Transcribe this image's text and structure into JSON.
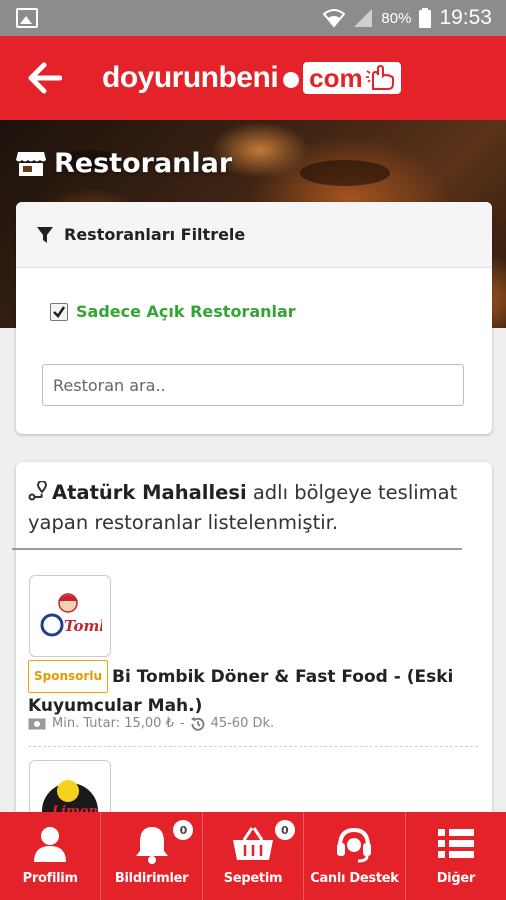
{
  "status_bar": {
    "battery": "80%",
    "time": "19:53"
  },
  "header": {
    "logo_main": "doyurunbeni",
    "logo_com": "com"
  },
  "page": {
    "title": "Restoranlar"
  },
  "filter": {
    "heading": "Restoranları Filtrele",
    "open_only_label": "Sadece Açık Restoranlar",
    "open_only_checked": true,
    "search_placeholder": "Restoran ara.."
  },
  "region": {
    "name": "Atatürk Mahallesi",
    "text": " adlı bölgeye teslimat yapan restoranlar listelenmiştir."
  },
  "restaurants": [
    {
      "sponsor_label": "Sponsorlu",
      "name": "Bi Tombik Döner & Fast Food - (Eski Kuyumcular Mah.)",
      "min_amount": "Min. Tutar: 15,00 ₺",
      "separator": "-",
      "delivery_time": "45-60 Dk."
    },
    {
      "logo_text": "Limon"
    }
  ],
  "bottom_nav": [
    {
      "label": "Profilim",
      "icon": "user-icon"
    },
    {
      "label": "Bildirimler",
      "icon": "bell-icon",
      "badge": "0"
    },
    {
      "label": "Sepetim",
      "icon": "basket-icon",
      "badge": "0"
    },
    {
      "label": "Canlı Destek",
      "icon": "headset-icon"
    },
    {
      "label": "Diğer",
      "icon": "list-menu-icon"
    }
  ],
  "colors": {
    "brand_red": "#e3222a",
    "open_green": "#33a533",
    "sponsor_orange": "#e89a00"
  }
}
